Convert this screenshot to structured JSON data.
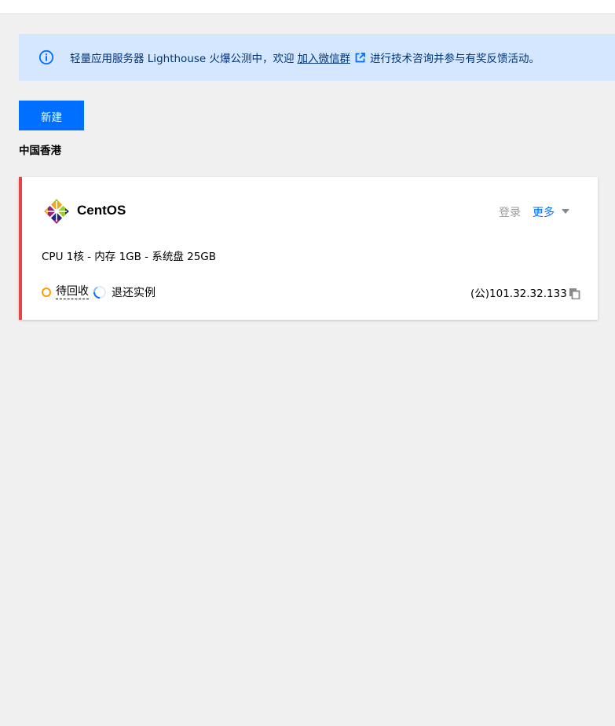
{
  "notice": {
    "text_before": "轻量应用服务器 Lighthouse 火爆公测中，欢迎",
    "link_text": "加入微信群",
    "text_after": "进行技术咨询并参与有奖反馈活动。",
    "icon": "info-icon",
    "link_icon": "external-link-icon"
  },
  "toolbar": {
    "new_label": "新建"
  },
  "region": {
    "title": "中国香港"
  },
  "instance": {
    "os_name": "CentOS",
    "os_icon": "centos-logo",
    "login_label": "登录",
    "more_label": "更多",
    "spec": "CPU 1核 - 内存 1GB - 系统盘 25GB",
    "status": "待回收",
    "action": "退还实例",
    "ip": "(公)101.32.32.133",
    "copy_icon": "copy-icon"
  },
  "colors": {
    "accent": "#006eff",
    "notice_bg": "#d5e7ff",
    "card_border": "#e54545",
    "status_dot": "#ff9d00"
  }
}
